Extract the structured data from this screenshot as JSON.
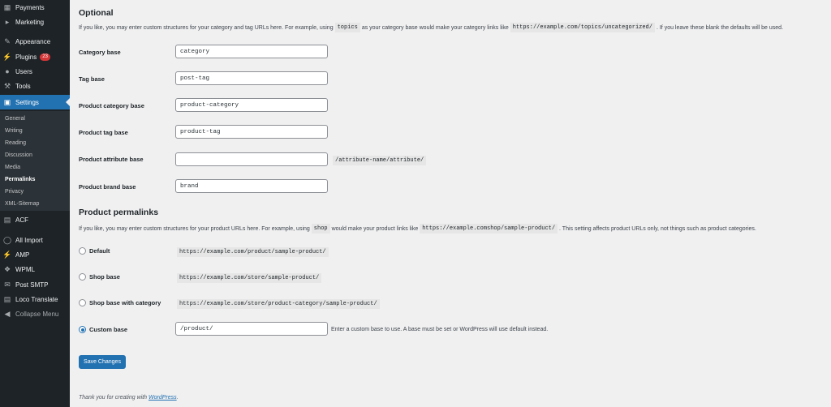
{
  "sidebar": {
    "items": [
      {
        "label": "Payments",
        "icon": "payments-icon"
      },
      {
        "label": "Marketing",
        "icon": "megaphone-icon"
      },
      {
        "label": "Appearance",
        "icon": "paintbrush-icon"
      },
      {
        "label": "Plugins",
        "icon": "plug-icon",
        "badge": "23"
      },
      {
        "label": "Users",
        "icon": "user-icon"
      },
      {
        "label": "Tools",
        "icon": "wrench-icon"
      },
      {
        "label": "Settings",
        "icon": "settings-icon"
      }
    ],
    "submenu": [
      "General",
      "Writing",
      "Reading",
      "Discussion",
      "Media",
      "Permalinks",
      "Privacy",
      "XML-Sitemap"
    ],
    "items2": [
      {
        "label": "ACF",
        "icon": "acf-icon"
      },
      {
        "label": "All Import",
        "icon": "import-icon"
      },
      {
        "label": "AMP",
        "icon": "amp-icon"
      },
      {
        "label": "WPML",
        "icon": "wpml-icon"
      },
      {
        "label": "Post SMTP",
        "icon": "mail-icon"
      },
      {
        "label": "Loco Translate",
        "icon": "translate-icon"
      },
      {
        "label": "Collapse Menu",
        "icon": "collapse-icon"
      }
    ]
  },
  "optional": {
    "title": "Optional",
    "desc_1": "If you like, you may enter custom structures for your category and tag URLs here. For example, using",
    "code_1": "topics",
    "desc_2": "as your category base would make your category links like",
    "code_2": "https://example.com/topics/uncategorized/",
    "desc_3": ". If you leave these blank the defaults will be used.",
    "fields": [
      {
        "label": "Category base",
        "value": "category"
      },
      {
        "label": "Tag base",
        "value": "post-tag"
      },
      {
        "label": "Product category base",
        "value": "product-category"
      },
      {
        "label": "Product tag base",
        "value": "product-tag"
      },
      {
        "label": "Product attribute base",
        "value": "",
        "suffix": "/attribute-name/attribute/"
      },
      {
        "label": "Product brand base",
        "value": "brand"
      }
    ]
  },
  "product": {
    "title": "Product permalinks",
    "desc_1": "If you like, you may enter custom structures for your product URLs here. For example, using",
    "code_1": "shop",
    "desc_2": "would make your product links like",
    "code_2": "https://example.comshop/sample-product/",
    "desc_3": ". This setting affects product URLs only, not things such as product categories.",
    "options": [
      {
        "label": "Default",
        "code": "https://example.com/product/sample-product/"
      },
      {
        "label": "Shop base",
        "code": "https://example.com/store/sample-product/"
      },
      {
        "label": "Shop base with category",
        "code": "https://example.com/store/product-category/sample-product/"
      },
      {
        "label": "Custom base",
        "value": "/product/",
        "note": "Enter a custom base to use. A base must be set or WordPress will use default instead."
      }
    ]
  },
  "save_label": "Save Changes",
  "footer": {
    "text": "Thank you for creating with",
    "link": "WordPress",
    "end": "."
  }
}
